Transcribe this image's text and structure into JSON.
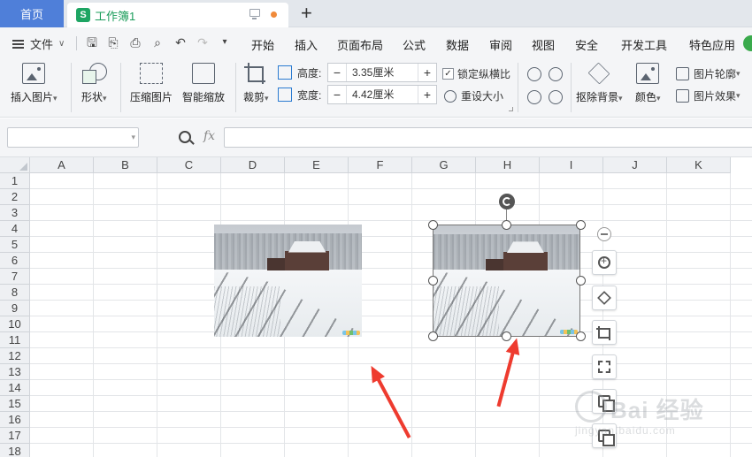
{
  "tabs": {
    "home_label": "首页",
    "doc_icon": "S",
    "doc_title": "工作簿1",
    "add_label": "+"
  },
  "menubar": {
    "file_label": "文件",
    "items": [
      "开始",
      "插入",
      "页面布局",
      "公式",
      "数据",
      "审阅",
      "视图",
      "安全",
      "开发工具",
      "特色应用"
    ]
  },
  "ribbon": {
    "insert_picture": "插入图片",
    "shape": "形状",
    "compress_picture": "压缩图片",
    "smart_scale": "智能缩放",
    "crop": "裁剪",
    "height_label": "高度:",
    "height_value": "3.35厘米",
    "width_label": "宽度:",
    "width_value": "4.42厘米",
    "lock_ratio": "锁定纵横比",
    "lock_checked": "✓",
    "reset_size": "重设大小",
    "remove_bg": "抠除背景",
    "color": "颜色",
    "picture_outline": "图片轮廓",
    "picture_effect": "图片效果",
    "minus": "−",
    "plus": "+",
    "dropdown": "▾"
  },
  "formula_bar": {
    "fx": "fx"
  },
  "sheet": {
    "columns": [
      "A",
      "B",
      "C",
      "D",
      "E",
      "F",
      "G",
      "H",
      "I",
      "J",
      "K"
    ],
    "rows": [
      "1",
      "2",
      "3",
      "4",
      "5",
      "6",
      "7",
      "8",
      "9",
      "10",
      "11",
      "12",
      "13",
      "14",
      "15",
      "16",
      "17",
      "18"
    ]
  },
  "watermark": {
    "text": "Bai 经验",
    "url": "jingyan.baidu.com"
  },
  "colors": {
    "accent": "#4f7fd9",
    "doc_green": "#1a9c5a",
    "arrow_red": "#ee3b2f"
  }
}
